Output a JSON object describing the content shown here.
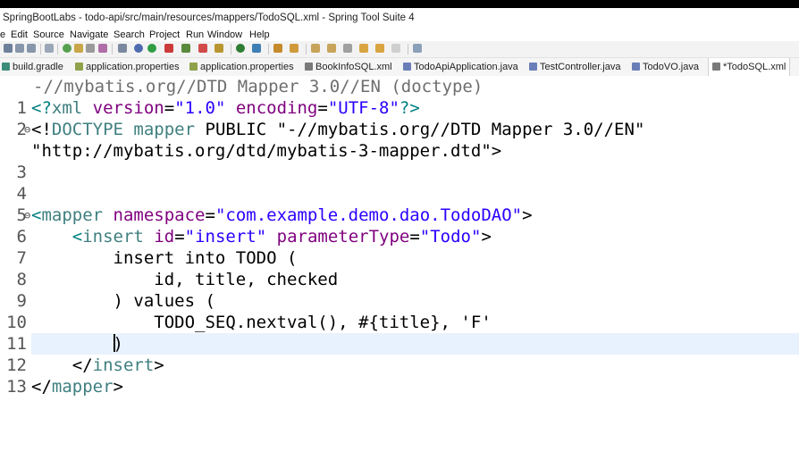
{
  "window": {
    "title": "SpringBootLabs - todo-api/src/main/resources/mappers/TodoSQL.xml - Spring Tool Suite 4"
  },
  "menu": [
    "e",
    "Edit",
    "Source",
    "Navigate",
    "Search",
    "Project",
    "Run",
    "Window",
    "Help"
  ],
  "tabs": [
    {
      "label": "build.gradle",
      "icon": "gradle-file-icon",
      "color": "#3d8c7a"
    },
    {
      "label": "application.properties",
      "icon": "properties-file-icon",
      "color": "#8fa14a"
    },
    {
      "label": "application.properties",
      "icon": "properties-file-icon",
      "color": "#8fa14a"
    },
    {
      "label": "BookInfoSQL.xml",
      "icon": "xml-file-icon",
      "color": "#7a7a7a"
    },
    {
      "label": "TodoApiApplication.java",
      "icon": "java-file-icon",
      "color": "#6a7fb8"
    },
    {
      "label": "TestController.java",
      "icon": "java-file-icon",
      "color": "#6a7fb8"
    },
    {
      "label": "TodoVO.java",
      "icon": "java-file-icon",
      "color": "#6a7fb8"
    },
    {
      "label": "*TodoSQL.xml",
      "icon": "xml-file-icon",
      "color": "#7a7a7a"
    }
  ],
  "editor": {
    "hover_hint": "-//mybatis.org//DTD Mapper 3.0//EN (doctype)",
    "lines": [
      {
        "n": "1",
        "fold": "",
        "tokens": [
          [
            "bracket",
            "<?"
          ],
          [
            "tag",
            "xml"
          ],
          [
            "plain",
            " "
          ],
          [
            "aname",
            "version"
          ],
          [
            "plain",
            "="
          ],
          [
            "aval",
            "\"1.0\""
          ],
          [
            "plain",
            " "
          ],
          [
            "aname",
            "encoding"
          ],
          [
            "plain",
            "="
          ],
          [
            "aval",
            "\"UTF-8\""
          ],
          [
            "bracket",
            "?>"
          ]
        ]
      },
      {
        "n": "2",
        "fold": "⊖",
        "tokens": [
          [
            "plain",
            "<!"
          ],
          [
            "tag",
            "DOCTYPE"
          ],
          [
            "plain",
            " "
          ],
          [
            "tag",
            "mapper"
          ],
          [
            "plain",
            " PUBLIC \"-//mybatis.org//DTD Mapper 3.0//EN\""
          ]
        ]
      },
      {
        "n": "",
        "fold": "",
        "tokens": [
          [
            "plain",
            "\"http://mybatis.org/dtd/mybatis-3-mapper.dtd\">"
          ]
        ]
      },
      {
        "n": "3",
        "fold": "",
        "tokens": []
      },
      {
        "n": "4",
        "fold": "",
        "tokens": []
      },
      {
        "n": "5",
        "fold": "⊖",
        "tokens": [
          [
            "bracket",
            "<"
          ],
          [
            "tag",
            "mapper"
          ],
          [
            "plain",
            " "
          ],
          [
            "aname",
            "namespace"
          ],
          [
            "plain",
            "="
          ],
          [
            "aval",
            "\"com.example.demo.dao.TodoDAO\""
          ],
          [
            "plain",
            ">"
          ]
        ]
      },
      {
        "n": "6",
        "fold": "",
        "tokens": [
          [
            "plain",
            "    "
          ],
          [
            "bracket",
            "<"
          ],
          [
            "tag",
            "insert"
          ],
          [
            "plain",
            " "
          ],
          [
            "aname",
            "id"
          ],
          [
            "plain",
            "="
          ],
          [
            "aval",
            "\"insert\""
          ],
          [
            "plain",
            " "
          ],
          [
            "aname",
            "parameterType"
          ],
          [
            "plain",
            "="
          ],
          [
            "aval",
            "\"Todo\""
          ],
          [
            "plain",
            ">"
          ]
        ]
      },
      {
        "n": "7",
        "fold": "",
        "tokens": [
          [
            "plain",
            "        insert into TODO ("
          ]
        ]
      },
      {
        "n": "8",
        "fold": "",
        "tokens": [
          [
            "plain",
            "            id, title, checked"
          ]
        ]
      },
      {
        "n": "9",
        "fold": "",
        "tokens": [
          [
            "plain",
            "        ) values ("
          ]
        ]
      },
      {
        "n": "10",
        "fold": "",
        "tokens": [
          [
            "plain",
            "            TODO_SEQ.nextval(), #{title}, 'F'"
          ]
        ]
      },
      {
        "n": "11",
        "fold": "",
        "cursor": true,
        "tokens": [
          [
            "plain",
            "        "
          ],
          [
            "caret",
            ""
          ],
          [
            "plain",
            ")"
          ]
        ]
      },
      {
        "n": "12",
        "fold": "",
        "tokens": [
          [
            "plain",
            "    </"
          ],
          [
            "tag",
            "insert"
          ],
          [
            "plain",
            ">"
          ]
        ]
      },
      {
        "n": "13",
        "fold": "",
        "tokens": [
          [
            "plain",
            "</"
          ],
          [
            "tag",
            "mapper"
          ],
          [
            "plain",
            ">"
          ]
        ]
      }
    ]
  }
}
